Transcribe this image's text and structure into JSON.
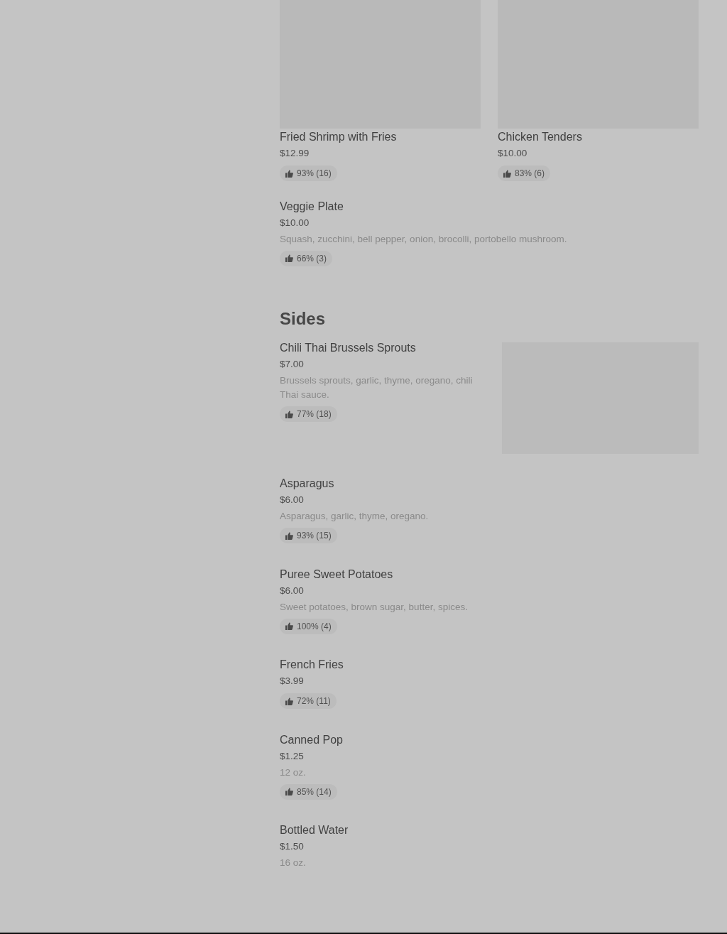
{
  "sections": [
    {
      "featured": [
        {
          "name": "Fried Shrimp with Fries",
          "price": "$12.99",
          "rating": "93% (16)"
        },
        {
          "name": "Chicken Tenders",
          "price": "$10.00",
          "rating": "83% (6)"
        }
      ],
      "items": [
        {
          "name": "Veggie Plate",
          "price": "$10.00",
          "description": "Squash, zucchini, bell pepper, onion, brocolli, portobello mushroom.",
          "rating": "66% (3)"
        }
      ]
    },
    {
      "heading": "Sides",
      "items": [
        {
          "name": "Chili Thai Brussels Sprouts",
          "price": "$7.00",
          "description": "Brussels sprouts, garlic, thyme, oregano, chili Thai sauce.",
          "rating": "77% (18)",
          "photo": true
        },
        {
          "name": "Asparagus",
          "price": "$6.00",
          "description": "Asparagus, garlic, thyme, oregano.",
          "rating": "93% (15)"
        },
        {
          "name": "Puree Sweet Potatoes",
          "price": "$6.00",
          "description": "Sweet potatoes, brown sugar, butter, spices.",
          "rating": "100% (4)"
        },
        {
          "name": "French Fries",
          "price": "$3.99",
          "rating": "72% (11)"
        },
        {
          "name": "Canned Pop",
          "price": "$1.25",
          "description": "12 oz.",
          "rating": "85% (14)"
        },
        {
          "name": "Bottled Water",
          "price": "$1.50",
          "description": "16 oz."
        }
      ]
    }
  ]
}
